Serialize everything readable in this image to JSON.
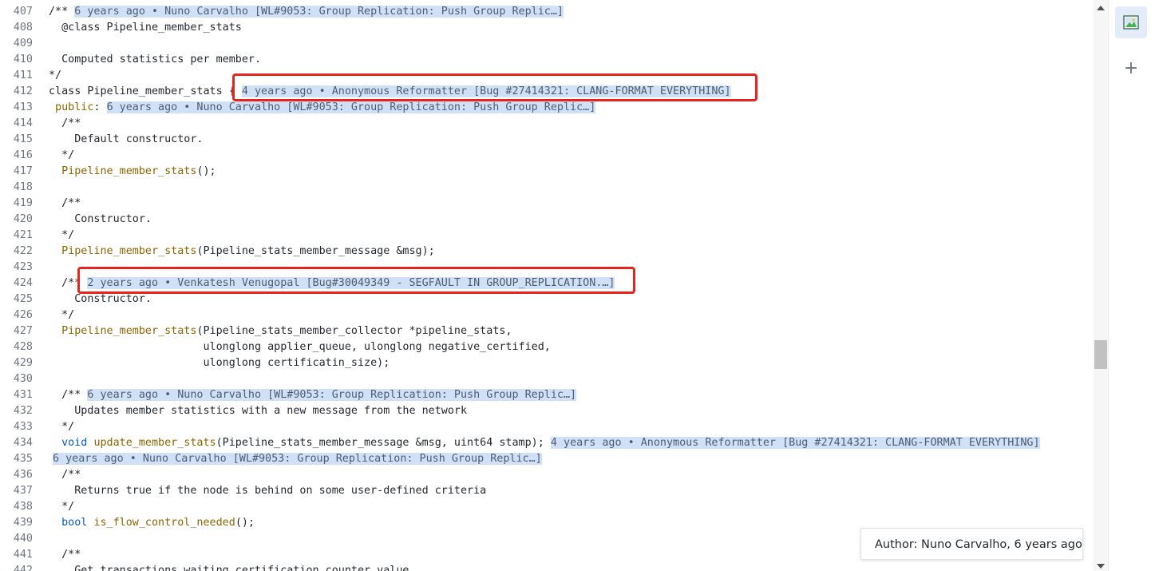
{
  "lines": {
    "l407": {
      "n": "407",
      "code": "/** ",
      "blame": "6 years ago • Nuno Carvalho [WL#9053: Group Replication: Push Group Replic…]"
    },
    "l408": {
      "n": "408",
      "code": "  @class Pipeline_member_stats"
    },
    "l409": {
      "n": "409"
    },
    "l410": {
      "n": "410",
      "code": "  Computed statistics per member."
    },
    "l411": {
      "n": "411",
      "code": "*/"
    },
    "l412": {
      "n": "412",
      "code": "class Pipeline_member_stats { ",
      "blame": "4 years ago • Anonymous Reformatter [Bug #27414321: CLANG-FORMAT EVERYTHING]"
    },
    "l413": {
      "n": "413",
      "kw": " public",
      "code": ": ",
      "blame": "6 years ago • Nuno Carvalho [WL#9053: Group Replication: Push Group Replic…]"
    },
    "l414": {
      "n": "414",
      "code": "  /**"
    },
    "l415": {
      "n": "415",
      "code": "    Default constructor."
    },
    "l416": {
      "n": "416",
      "code": "  */"
    },
    "l417": {
      "n": "417",
      "fn": "Pipeline_member_stats",
      "code": "();"
    },
    "l418": {
      "n": "418"
    },
    "l419": {
      "n": "419",
      "code": "  /**"
    },
    "l420": {
      "n": "420",
      "code": "    Constructor."
    },
    "l421": {
      "n": "421",
      "code": "  */"
    },
    "l422": {
      "n": "422",
      "fn": "Pipeline_member_stats",
      "code": "(Pipeline_stats_member_message &msg);"
    },
    "l423": {
      "n": "423"
    },
    "l424": {
      "n": "424",
      "code": "  /** ",
      "blame": "2 years ago • Venkatesh Venugopal [Bug#30049349 - SEGFAULT IN GROUP_REPLICATION.…]"
    },
    "l425": {
      "n": "425",
      "code": "    Constructor."
    },
    "l426": {
      "n": "426",
      "code": "  */"
    },
    "l427": {
      "n": "427",
      "fn": "Pipeline_member_stats",
      "code": "(Pipeline_stats_member_collector *pipeline_stats,"
    },
    "l428": {
      "n": "428",
      "code": "                        ulonglong applier_queue, ulonglong negative_certified,"
    },
    "l429": {
      "n": "429",
      "code": "                        ulonglong certificatin_size);"
    },
    "l430": {
      "n": "430"
    },
    "l431": {
      "n": "431",
      "code": "  /** ",
      "blame": "6 years ago • Nuno Carvalho [WL#9053: Group Replication: Push Group Replic…]"
    },
    "l432": {
      "n": "432",
      "code": "    Updates member statistics with a new message from the network"
    },
    "l433": {
      "n": "433",
      "code": "  */"
    },
    "l434": {
      "n": "434",
      "kw": "void",
      "fn": "update_member_stats",
      "code": "(Pipeline_stats_member_message &msg, uint64 stamp); ",
      "blame": "4 years ago • Anonymous Reformatter [Bug #27414321: CLANG-FORMAT EVERYTHING]"
    },
    "l435": {
      "n": "435",
      "code": " ",
      "blame": "6 years ago • Nuno Carvalho [WL#9053: Group Replication: Push Group Replic…]"
    },
    "l436": {
      "n": "436",
      "code": "  /**"
    },
    "l437": {
      "n": "437",
      "code": "    Returns true if the node is behind on some user-defined criteria"
    },
    "l438": {
      "n": "438",
      "code": "  */"
    },
    "l439": {
      "n": "439",
      "kw": "bool",
      "fn": "is_flow_control_needed",
      "code": "();"
    },
    "l440": {
      "n": "440"
    },
    "l441": {
      "n": "441",
      "code": "  /**"
    },
    "l442": {
      "n": "442",
      "code": "    Get transactions waiting certification counter value."
    }
  },
  "tooltip": {
    "text": "Author: Nuno Carvalho, 6 years ago"
  },
  "activity": {
    "active_icon": "image-preview-icon",
    "plus_icon": "plus-icon"
  },
  "colors": {
    "highlight_border": "#e8241c",
    "blame_background": "#d0e1f7",
    "keyword": "#0a58c7",
    "function": "#8a6500"
  }
}
